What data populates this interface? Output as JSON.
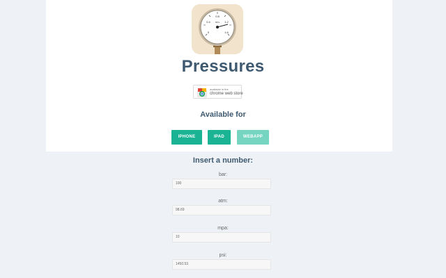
{
  "app": {
    "title": "Pressures",
    "icon": "pressure-gauge-icon",
    "gauge_scale": [
      "0.8",
      "0.4",
      "1.2",
      "0",
      "1.6"
    ],
    "gauge_unit": "MPa"
  },
  "store_badge": {
    "small_text": "available in the",
    "big_text": "chrome web store"
  },
  "available_for": "Available for",
  "platforms": [
    {
      "label": "IPHONE",
      "state": "active"
    },
    {
      "label": "IPAD",
      "state": "active"
    },
    {
      "label": "WEBAPP",
      "state": "current"
    }
  ],
  "converter": {
    "heading": "Insert a number:",
    "fields": [
      {
        "label": "bar:",
        "value": "100"
      },
      {
        "label": "atm:",
        "value": "98.69"
      },
      {
        "label": "mpa:",
        "value": "10"
      },
      {
        "label": "psi:",
        "value": "1450.53"
      }
    ]
  },
  "colors": {
    "accent": "#1ab394",
    "accent_light": "#76d5c1",
    "heading": "#3f5a70",
    "background": "#eef2f6"
  }
}
